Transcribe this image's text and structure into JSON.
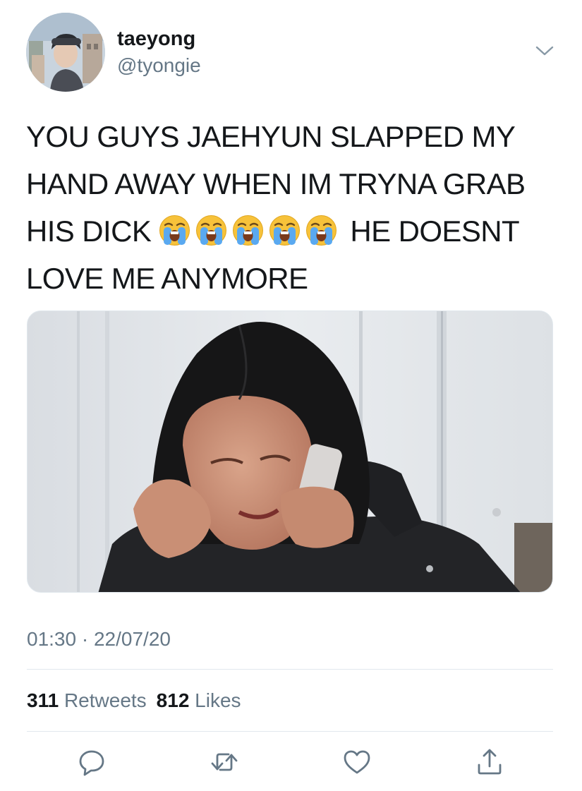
{
  "user": {
    "display_name": "taeyong",
    "handle": "@tyongie"
  },
  "tweet": {
    "text_before": "YOU GUYS JAEHYUN SLAPPED MY HAND AWAY WHEN IM TRYNA GRAB HIS DICK",
    "emoji": [
      "loudly-crying-face",
      "loudly-crying-face",
      "loudly-crying-face",
      "loudly-crying-face",
      "loudly-crying-face"
    ],
    "text_after": "HE DOESNT LOVE ME ANYMORE"
  },
  "meta": {
    "time": "01:30",
    "separator": "·",
    "date": "22/07/20"
  },
  "stats": {
    "retweets_count": "311",
    "retweets_label": "Retweets",
    "likes_count": "812",
    "likes_label": "Likes"
  },
  "actions": [
    "reply-icon",
    "retweet-icon",
    "like-icon",
    "share-icon"
  ],
  "colors": {
    "text": "#14171a",
    "secondary": "#657786",
    "divider": "#e1e8ed",
    "icon": "#657786"
  }
}
